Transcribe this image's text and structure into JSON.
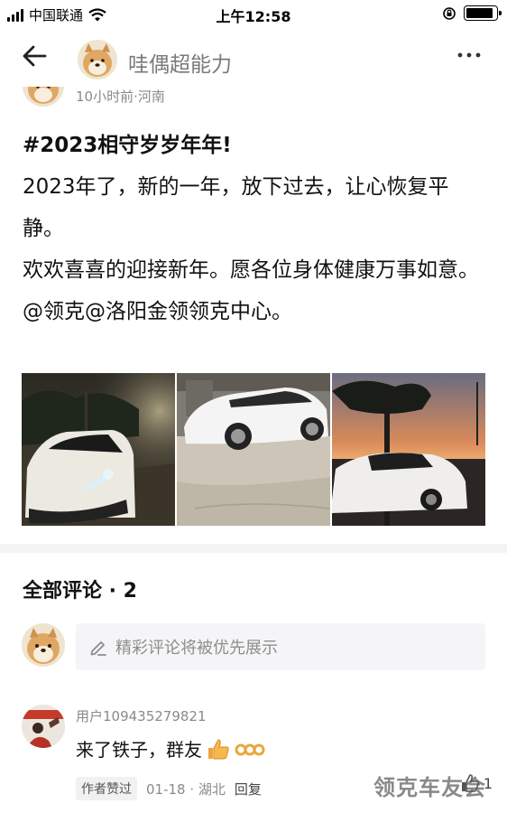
{
  "status_bar": {
    "carrier": "中国联通",
    "time": "上午12:58",
    "battery_level": 0.9
  },
  "nav": {
    "back_icon": "arrow-left-icon",
    "author_name": "哇偶超能力",
    "more_icon": "more-dots-icon"
  },
  "post": {
    "meta": "10小时前·河南",
    "hashtag": "#2023相守岁岁年年!",
    "lines": [
      "2023年了，新的一年，放下过去，让心恢复平静。",
      "欢欢喜喜的迎接新年。愿各位身体健康万事如意。",
      "@领克@洛阳金领领克中心。"
    ]
  },
  "comments": {
    "title": "全部评论 · 2",
    "input_placeholder": "精彩评论将被优先展示",
    "edit_icon": "pencil-icon",
    "items": [
      {
        "user": "用户109435279821",
        "text": "来了铁子，群友",
        "badge": "作者赞过",
        "time_location": "01-18 · 湖北",
        "reply": "回复",
        "likes": "1"
      }
    ]
  },
  "watermark": "领克车友会",
  "colors": {
    "text": "#111111",
    "muted": "#8a8a8a",
    "input_bg": "#f5f5f7",
    "divider": "#f4f4f4"
  }
}
